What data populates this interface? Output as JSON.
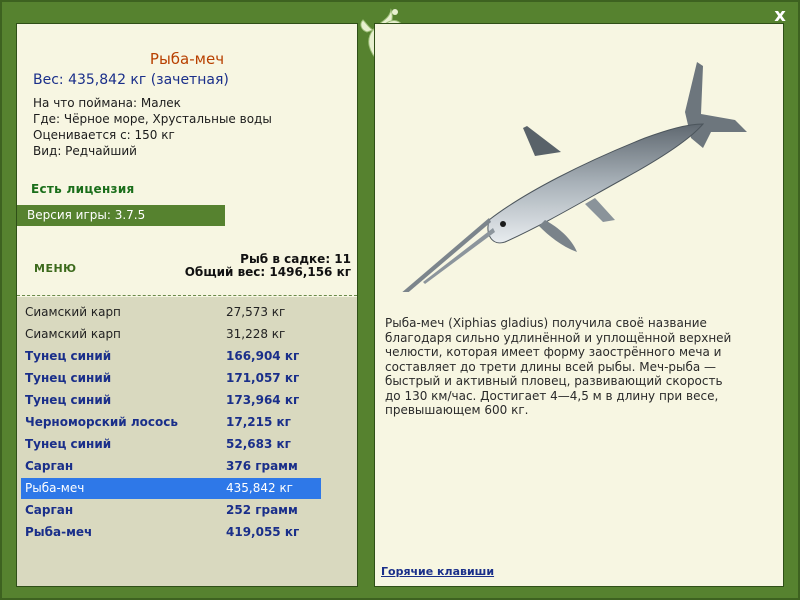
{
  "close_label": "x",
  "fish": {
    "title": "Рыба-меч",
    "weight": "Вес: 435,842 кг (зачетная)",
    "bait": "На что поймана: Малек",
    "location": "Где: Чёрное море, Хрустальные воды",
    "min_weight": "Оценивается с: 150 кг",
    "rarity": "Вид: Редчайший",
    "description": "Рыба-меч (Xiphias gladius) получила своё название благодаря сильно удлинённой и уплощённой верхней челюсти, которая имеет форму заострённого меча и составляет до трети длины всей рыбы. Меч-рыба — быстрый и активный пловец, развивающий скорость до 130 км/час. Достигает 4—4,5 м в длину при весе, превышающем 600 кг."
  },
  "license": "Есть лицензия",
  "version": "Версия игры: 3.7.5",
  "menu_label": "МЕНЮ",
  "keep": {
    "count": "Рыб в садке: 11",
    "total": "Общий вес: 1496,156 кг"
  },
  "catch_list": [
    {
      "name": "Сиамский карп",
      "weight": "27,573 кг",
      "style": "plain"
    },
    {
      "name": "Сиамский карп",
      "weight": "31,228 кг",
      "style": "plain"
    },
    {
      "name": "Тунец синий",
      "weight": "166,904 кг",
      "style": "bold"
    },
    {
      "name": "Тунец синий",
      "weight": "171,057 кг",
      "style": "bold"
    },
    {
      "name": "Тунец синий",
      "weight": "173,964 кг",
      "style": "bold"
    },
    {
      "name": "Черноморский лосось",
      "weight": "17,215 кг",
      "style": "bold"
    },
    {
      "name": "Тунец синий",
      "weight": "52,683 кг",
      "style": "bold"
    },
    {
      "name": "Сарган",
      "weight": "376 грамм",
      "style": "bold"
    },
    {
      "name": "Рыба-меч",
      "weight": "435,842 кг",
      "style": "sel"
    },
    {
      "name": "Сарган",
      "weight": "252 грамм",
      "style": "bold"
    },
    {
      "name": "Рыба-меч",
      "weight": "419,055 кг",
      "style": "bold"
    }
  ],
  "hotkeys": "Горячие клавиши",
  "colors": {
    "frame": "#56822f",
    "panel": "#f7f6e2",
    "list_bg": "#d9d9bf",
    "title": "#b84000",
    "accent_blue": "#1a2f8a",
    "selected": "#2e78e8"
  },
  "icons": [
    "close-icon",
    "leaf-ornament-icon",
    "swordfish-image"
  ]
}
